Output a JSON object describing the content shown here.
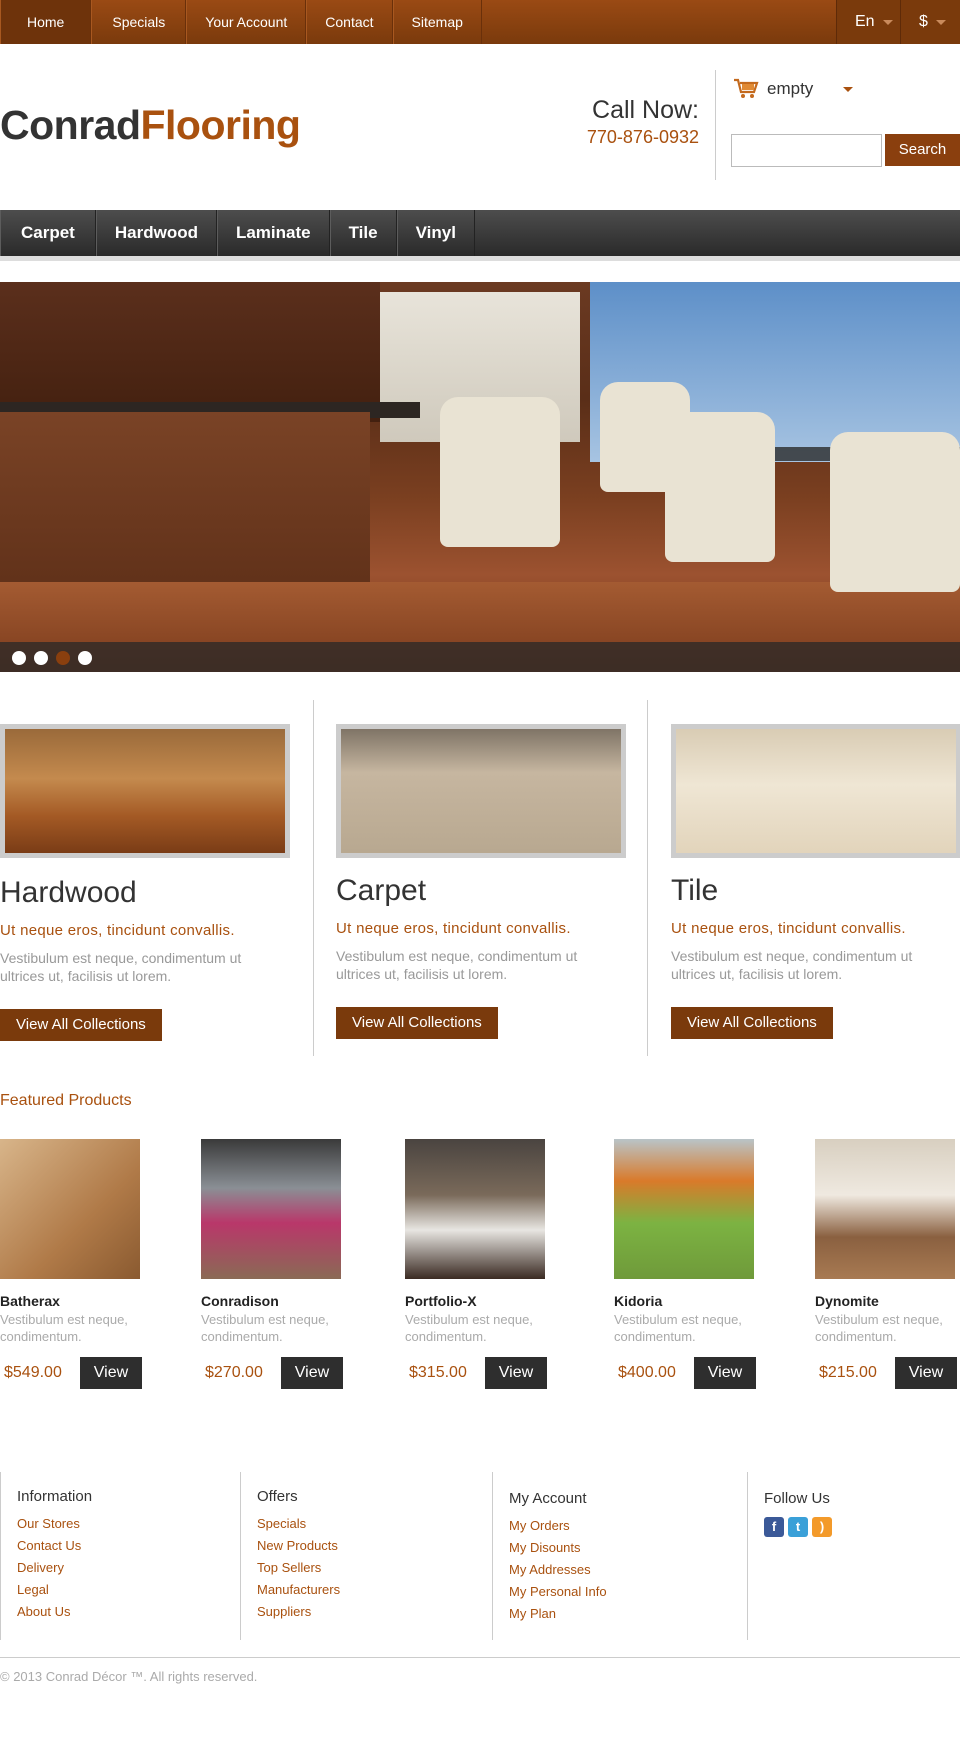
{
  "topnav": {
    "items": [
      "Home",
      "Specials",
      "Your Account",
      "Contact",
      "Sitemap"
    ],
    "language": "En",
    "currency": "$"
  },
  "header": {
    "logo_part1": "Conrad",
    "logo_part2": "Flooring",
    "call_label": "Call Now:",
    "phone": "770-876-0932",
    "cart_status": "empty",
    "search_button": "Search",
    "search_placeholder": ""
  },
  "categories": [
    "Carpet",
    "Hardwood",
    "Laminate",
    "Tile",
    "Vinyl"
  ],
  "slider": {
    "active_index": 2,
    "count": 4
  },
  "features": [
    {
      "title": "Hardwood",
      "subtitle": "Ut neque eros, tincidunt convallis.",
      "desc": "Vestibulum est neque, condimentum ut ultrices ut, facilisis ut lorem.",
      "button": "View All Collections"
    },
    {
      "title": "Carpet",
      "subtitle": "Ut neque eros, tincidunt convallis.",
      "desc": "Vestibulum est neque, condimentum ut ultrices ut, facilisis ut lorem.",
      "button": "View All Collections"
    },
    {
      "title": "Tile",
      "subtitle": "Ut neque eros, tincidunt convallis.",
      "desc": "Vestibulum est neque, condimentum ut ultrices ut, facilisis ut lorem.",
      "button": "View All Collections"
    }
  ],
  "featured": {
    "heading": "Featured Products",
    "products": [
      {
        "name": "Batherax",
        "desc": "Vestibulum est neque, condimentum.",
        "price": "$549.00",
        "button": "View"
      },
      {
        "name": "Conradison",
        "desc": "Vestibulum est neque, condimentum.",
        "price": "$270.00",
        "button": "View"
      },
      {
        "name": "Portfolio-X",
        "desc": "Vestibulum est neque, condimentum.",
        "price": "$315.00",
        "button": "View"
      },
      {
        "name": "Kidoria",
        "desc": "Vestibulum est neque, condimentum.",
        "price": "$400.00",
        "button": "View"
      },
      {
        "name": "Dynomite",
        "desc": "Vestibulum est neque, condimentum.",
        "price": "$215.00",
        "button": "View"
      }
    ]
  },
  "footer": {
    "information": {
      "title": "Information",
      "links": [
        "Our Stores",
        "Contact Us",
        "Delivery",
        "Legal",
        "About Us"
      ]
    },
    "offers": {
      "title": "Offers",
      "links": [
        "Specials",
        "New Products",
        "Top Sellers",
        "Manufacturers",
        "Suppliers"
      ]
    },
    "account": {
      "title": "My Account",
      "links": [
        "My Orders",
        "My Disounts",
        "My Addresses",
        "My Personal Info",
        "My Plan"
      ]
    },
    "follow": {
      "title": "Follow Us",
      "icons": [
        "facebook-icon",
        "twitter-icon",
        "rss-icon"
      ]
    },
    "copyright": "© 2013 Conrad Décor ™. All rights reserved."
  },
  "colors": {
    "brand": "#a9510f",
    "topbar": "#8a4210",
    "dark": "#2e2e2e"
  }
}
